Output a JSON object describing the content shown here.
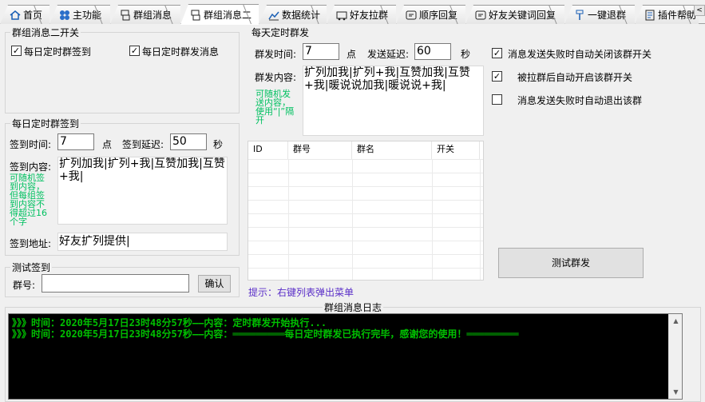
{
  "tabs": [
    {
      "label": "首页",
      "icon": "home-icon"
    },
    {
      "label": "主功能",
      "icon": "clover-icon"
    },
    {
      "label": "群组消息",
      "icon": "chat-icon"
    },
    {
      "label": "群组消息二",
      "icon": "chat-icon"
    },
    {
      "label": "数据统计",
      "icon": "chart-icon"
    },
    {
      "label": "好友拉群",
      "icon": "cart-icon"
    },
    {
      "label": "顺序回复",
      "icon": "reply-icon"
    },
    {
      "label": "好友关键词回复",
      "icon": "reply-icon"
    },
    {
      "label": "一键退群",
      "icon": "pin-icon"
    },
    {
      "label": "插件帮助",
      "icon": "doc-icon"
    }
  ],
  "switch_group": {
    "title": "群组消息二开关",
    "daily_signin": {
      "label": "每日定时群签到",
      "checked": true
    },
    "daily_message": {
      "label": "每日定时群发消息",
      "checked": true
    }
  },
  "signin": {
    "title": "每日定时群签到",
    "time_label": "签到时间:",
    "time_value": "7",
    "hour_unit": "点",
    "delay_label": "签到延迟:",
    "delay_value": "50",
    "sec_unit": "秒",
    "content_label": "签到内容:",
    "content_value": "扩列加我|扩列+我|互赞加我|互赞+我|",
    "hint": "可随机签到内容，但每组签到内容不得超过16个字",
    "address_label": "签到地址:",
    "address_value": "好友扩列提供|"
  },
  "test_signin": {
    "title": "测试签到",
    "group_label": "群号:",
    "group_value": "",
    "confirm_label": "确认"
  },
  "broadcast": {
    "title": "每天定时群发",
    "time_label": "群发时间:",
    "time_value": "7",
    "hour_unit": "点",
    "delay_label": "发送延迟:",
    "delay_value": "60",
    "sec_unit": "秒",
    "content_label": "群发内容:",
    "content_value": "扩列加我|扩列+我|互赞加我|互赞+我|暖说说加我|暖说说+我|",
    "hint": "可随机发送内容，使用“|”隔开",
    "table_columns": [
      "ID",
      "群号",
      "群名",
      "开关"
    ],
    "tip": "提示：右键列表弹出菜单"
  },
  "options": {
    "close_on_fail": {
      "label": "消息发送失败时自动关闭该群开关",
      "checked": true
    },
    "auto_open": {
      "label": "被拉群后自动开启该群开关",
      "checked": true
    },
    "exit_on_fail": {
      "label": "消息发送失败时自动退出该群",
      "checked": false
    },
    "test_button": "测试群发"
  },
  "log": {
    "title": "群组消息日志",
    "lines": [
      "》》》时间：2020年5月17日23时48分57秒——内容：定时群发开始执行...",
      "》》》时间：2020年5月17日23时48分57秒——内容：═════════每日定时群发已执行完毕，感谢您的使用！═════════"
    ]
  }
}
